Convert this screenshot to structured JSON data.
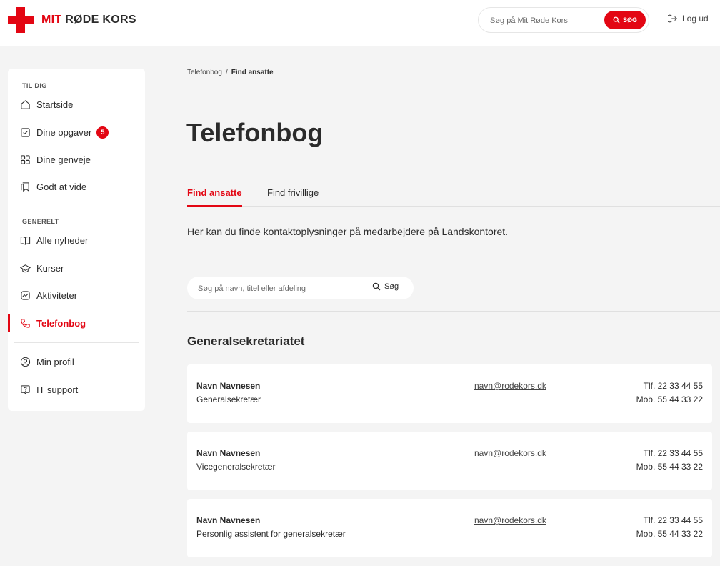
{
  "header": {
    "logo_prefix": "MIT",
    "logo_suffix": "RØDE KORS",
    "search_placeholder": "Søg på Mit Røde Kors",
    "search_button": "SØG",
    "logout_label": "Log ud",
    "brand_color": "#e30613"
  },
  "sidebar": {
    "sections": [
      {
        "title": "TIL DIG",
        "items": [
          {
            "label": "Startside",
            "icon": "home-icon"
          },
          {
            "label": "Dine opgaver",
            "icon": "checkbox-icon",
            "badge": "5"
          },
          {
            "label": "Dine genveje",
            "icon": "grid-icon"
          },
          {
            "label": "Godt at vide",
            "icon": "bookmark-icon"
          }
        ]
      },
      {
        "title": "GENERELT",
        "items": [
          {
            "label": "Alle nyheder",
            "icon": "book-icon"
          },
          {
            "label": "Kurser",
            "icon": "graduation-cap-icon"
          },
          {
            "label": "Aktiviteter",
            "icon": "activity-icon"
          },
          {
            "label": "Telefonbog",
            "icon": "phone-icon",
            "active": true
          }
        ]
      },
      {
        "title": "",
        "items": [
          {
            "label": "Min profil",
            "icon": "user-icon"
          },
          {
            "label": "IT support",
            "icon": "help-icon"
          }
        ]
      }
    ]
  },
  "breadcrumb": {
    "parent": "Telefonbog",
    "separator": "/",
    "current": "Find ansatte"
  },
  "page": {
    "title": "Telefonbog",
    "tabs": [
      {
        "label": "Find ansatte",
        "active": true
      },
      {
        "label": "Find frivillige",
        "active": false
      }
    ],
    "intro": "Her kan du finde kontaktoplysninger på medarbejdere på Landskontoret.",
    "search_placeholder": "Søg på navn, titel eller afdeling",
    "search_button": "Søg"
  },
  "directory": {
    "group_title": "Generalsekretariatet",
    "entries": [
      {
        "name": "Navn Navnesen",
        "title": "Generalsekretær",
        "email": "navn@rodekors.dk",
        "phone": "Tlf. 22 33 44 55",
        "mobile": "Mob. 55 44 33 22"
      },
      {
        "name": "Navn Navnesen",
        "title": "Vicegeneralsekretær",
        "email": "navn@rodekors.dk",
        "phone": "Tlf. 22 33 44 55",
        "mobile": "Mob. 55 44 33 22"
      },
      {
        "name": "Navn Navnesen",
        "title": "Personlig assistent for generalsekretær",
        "email": "navn@rodekors.dk",
        "phone": "Tlf. 22 33 44 55",
        "mobile": "Mob. 55 44 33 22"
      }
    ]
  }
}
